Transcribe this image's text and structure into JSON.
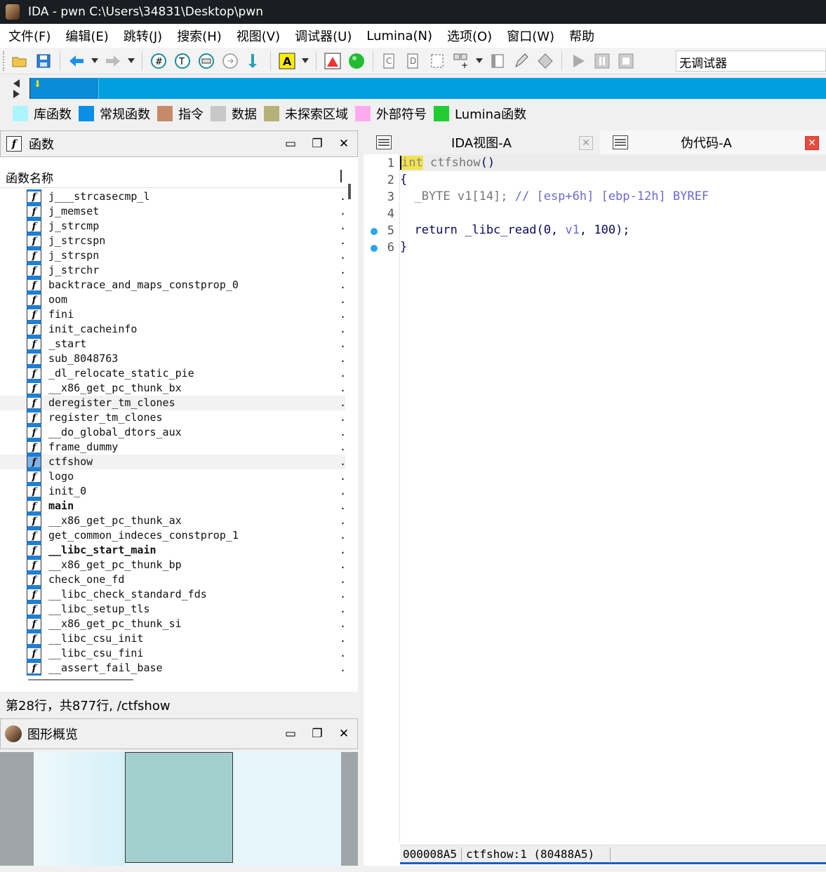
{
  "window": {
    "title": "IDA - pwn C:\\Users\\34831\\Desktop\\pwn"
  },
  "menu": [
    "文件(F)",
    "编辑(E)",
    "跳转(J)",
    "搜索(H)",
    "视图(V)",
    "调试器(U)",
    "Lumina(N)",
    "选项(O)",
    "窗口(W)",
    "帮助"
  ],
  "toolbar": {
    "debugger_select": "无调试器"
  },
  "legend": [
    {
      "label": "库函数",
      "color": "#aaf5ff"
    },
    {
      "label": "常规函数",
      "color": "#0a8ee6"
    },
    {
      "label": "指令",
      "color": "#c58a6a"
    },
    {
      "label": "数据",
      "color": "#c8c8c8"
    },
    {
      "label": "未探索区域",
      "color": "#b5b279"
    },
    {
      "label": "外部符号",
      "color": "#ffaaee"
    },
    {
      "label": "Lumina函数",
      "color": "#22cc33"
    }
  ],
  "functions_panel": {
    "title": "函数",
    "column_header": "函数名称",
    "items": [
      {
        "name": "j___strcasecmp_l"
      },
      {
        "name": "j_memset"
      },
      {
        "name": "j_strcmp"
      },
      {
        "name": "j_strcspn"
      },
      {
        "name": "j_strspn"
      },
      {
        "name": "j_strchr"
      },
      {
        "name": "backtrace_and_maps_constprop_0"
      },
      {
        "name": "oom"
      },
      {
        "name": "fini"
      },
      {
        "name": "init_cacheinfo"
      },
      {
        "name": "_start"
      },
      {
        "name": "sub_8048763"
      },
      {
        "name": "_dl_relocate_static_pie"
      },
      {
        "name": "__x86_get_pc_thunk_bx"
      },
      {
        "name": "deregister_tm_clones"
      },
      {
        "name": "register_tm_clones"
      },
      {
        "name": "__do_global_dtors_aux"
      },
      {
        "name": "frame_dummy"
      },
      {
        "name": "ctfshow"
      },
      {
        "name": "logo"
      },
      {
        "name": "init_0"
      },
      {
        "name": "main"
      },
      {
        "name": "__x86_get_pc_thunk_ax"
      },
      {
        "name": "get_common_indeces_constprop_1"
      },
      {
        "name": "__libc_start_main"
      },
      {
        "name": "__x86_get_pc_thunk_bp"
      },
      {
        "name": "check_one_fd"
      },
      {
        "name": "__libc_check_standard_fds"
      },
      {
        "name": "__libc_setup_tls"
      },
      {
        "name": "__x86_get_pc_thunk_si"
      },
      {
        "name": "__libc_csu_init"
      },
      {
        "name": "__libc_csu_fini"
      },
      {
        "name": "__assert_fail_base"
      }
    ],
    "status": "第28行，共877行, /ctfshow"
  },
  "graph_overview": {
    "title": "图形概览"
  },
  "tabs": [
    {
      "label": "IDA视图-A"
    },
    {
      "label": "伪代码-A"
    }
  ],
  "pseudocode": {
    "line_numbers": [
      "1",
      "2",
      "3",
      "4",
      "5",
      "6"
    ],
    "line1": {
      "kw": "int",
      "rest": " ctfshow",
      "paren": "()"
    },
    "line2": "{",
    "line3": {
      "decl": "  _BYTE v1[14]; ",
      "comment": "// [esp+6h] [ebp-12h] BYREF"
    },
    "line5": {
      "pre": "  return _libc_read(0, ",
      "var": "v1",
      "post": ", 100);"
    },
    "line6": "}"
  },
  "status_bar": {
    "address": "000008A5",
    "location": "ctfshow:1 (80488A5)"
  }
}
